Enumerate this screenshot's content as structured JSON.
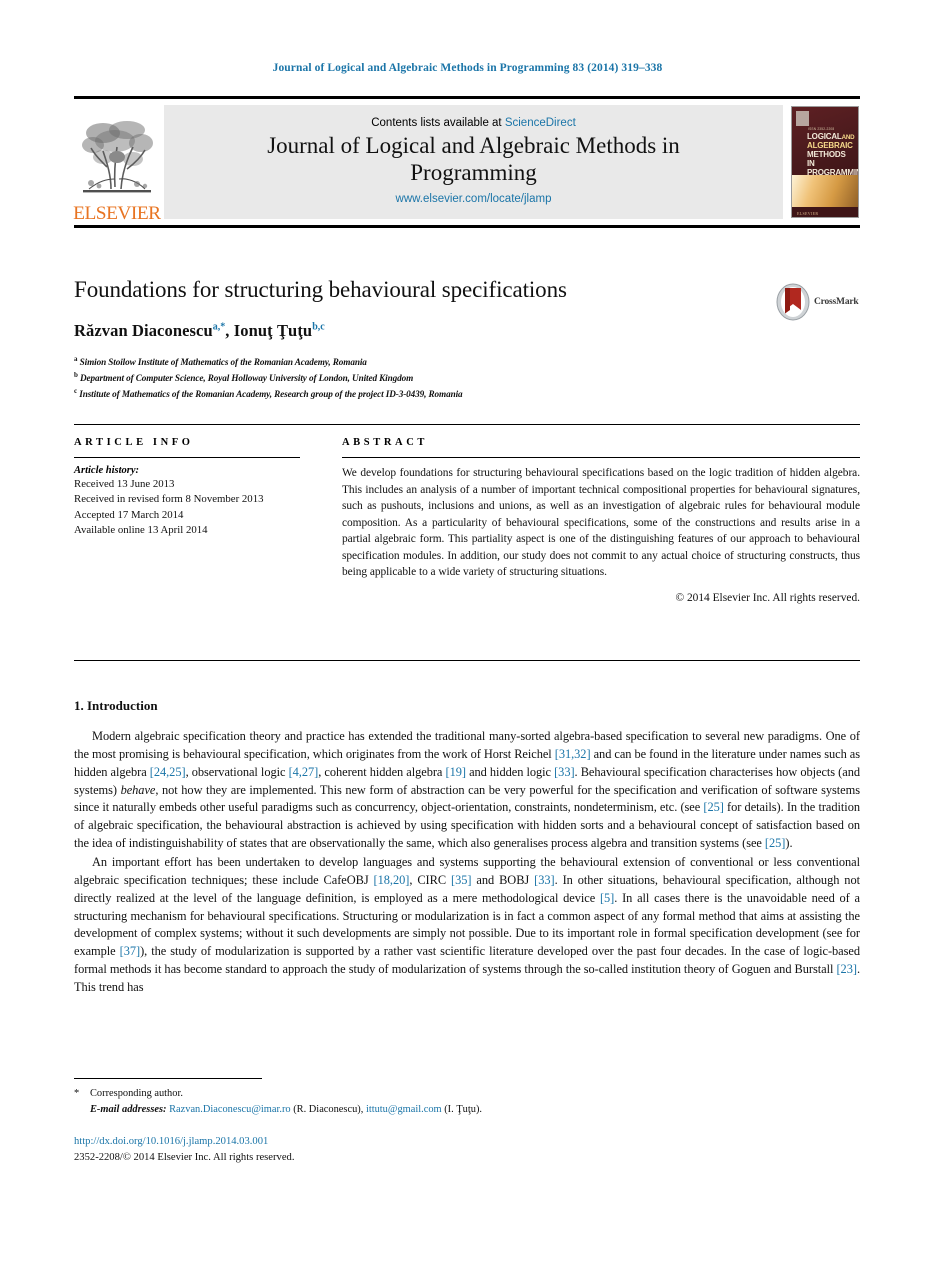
{
  "running_head": "Journal of Logical and Algebraic Methods in Programming 83 (2014) 319–338",
  "masthead": {
    "publisher_name": "ELSEVIER",
    "contents_prefix": "Contents lists available at",
    "contents_link": "ScienceDirect",
    "journal_title": "Journal of Logical and Algebraic Methods in Programming",
    "journal_url": "www.elsevier.com/locate/jlamp",
    "cover": {
      "kicker": "ISSN 2352-2208",
      "line1": "LOGICAL",
      "line1_small": "AND",
      "line2": "ALGEBRAIC",
      "line3": "METHODS IN",
      "line4": "PROGRAMMING",
      "footer": "ELSEVIER"
    }
  },
  "article": {
    "title": "Foundations for structuring behavioural specifications",
    "authors": [
      {
        "name": "Răzvan Diaconescu",
        "marks": "a,*"
      },
      {
        "name": "Ionuţ Ţuţu",
        "marks": "b,c"
      }
    ],
    "authors_separator": ", ",
    "affiliations": [
      {
        "mark": "a",
        "text": "Simion Stoilow Institute of Mathematics of the Romanian Academy, Romania"
      },
      {
        "mark": "b",
        "text": "Department of Computer Science, Royal Holloway University of London, United Kingdom"
      },
      {
        "mark": "c",
        "text": "Institute of Mathematics of the Romanian Academy, Research group of the project ID-3-0439, Romania"
      }
    ],
    "crossmark_label": "CrossMark"
  },
  "article_info": {
    "heading": "ARTICLE INFO",
    "history_label": "Article history:",
    "history": [
      "Received 13 June 2013",
      "Received in revised form 8 November 2013",
      "Accepted 17 March 2014",
      "Available online 13 April 2014"
    ]
  },
  "abstract": {
    "heading": "ABSTRACT",
    "text": "We develop foundations for structuring behavioural specifications based on the logic tradition of hidden algebra. This includes an analysis of a number of important technical compositional properties for behavioural signatures, such as pushouts, inclusions and unions, as well as an investigation of algebraic rules for behavioural module composition. As a particularity of behavioural specifications, some of the constructions and results arise in a partial algebraic form. This partiality aspect is one of the distinguishing features of our approach to behavioural specification modules. In addition, our study does not commit to any actual choice of structuring constructs, thus being applicable to a wide variety of structuring situations.",
    "copyright": "© 2014 Elsevier Inc. All rights reserved."
  },
  "body": {
    "section_number": "1.",
    "section_title": "Introduction",
    "paragraphs": [
      {
        "segments": [
          {
            "t": "Modern algebraic specification theory and practice has extended the traditional many-sorted algebra-based specification to several new paradigms. One of the most promising is behavioural specification, which originates from the work of Horst Reichel "
          },
          {
            "t": "[31,32]",
            "k": "ref"
          },
          {
            "t": " and can be found in the literature under names such as hidden algebra "
          },
          {
            "t": "[24,25]",
            "k": "ref"
          },
          {
            "t": ", observational logic "
          },
          {
            "t": "[4,27]",
            "k": "ref"
          },
          {
            "t": ", coherent hidden algebra "
          },
          {
            "t": "[19]",
            "k": "ref"
          },
          {
            "t": " and hidden logic "
          },
          {
            "t": "[33]",
            "k": "ref"
          },
          {
            "t": ". Behavioural specification characterises how objects (and systems) "
          },
          {
            "t": "behave",
            "k": "it"
          },
          {
            "t": ", not how they are implemented. This new form of abstraction can be very powerful for the specification and verification of software systems since it naturally embeds other useful paradigms such as concurrency, object-orientation, constraints, nondeterminism, etc. (see "
          },
          {
            "t": "[25]",
            "k": "ref"
          },
          {
            "t": " for details). In the tradition of algebraic specification, the behavioural abstraction is achieved by using specification with hidden sorts and a behavioural concept of satisfaction based on the idea of indistinguishability of states that are observationally the same, which also generalises process algebra and transition systems (see "
          },
          {
            "t": "[25]",
            "k": "ref"
          },
          {
            "t": ")."
          }
        ]
      },
      {
        "segments": [
          {
            "t": "An important effort has been undertaken to develop languages and systems supporting the behavioural extension of conventional or less conventional algebraic specification techniques; these include CafeOBJ "
          },
          {
            "t": "[18,20]",
            "k": "ref"
          },
          {
            "t": ", CIRC "
          },
          {
            "t": "[35]",
            "k": "ref"
          },
          {
            "t": " and BOBJ "
          },
          {
            "t": "[33]",
            "k": "ref"
          },
          {
            "t": ". In other situations, behavioural specification, although not directly realized at the level of the language definition, is employed as a mere methodological device "
          },
          {
            "t": "[5]",
            "k": "ref"
          },
          {
            "t": ". In all cases there is the unavoidable need of a structuring mechanism for behavioural specifications. Structuring or modularization is in fact a common aspect of any formal method that aims at assisting the development of complex systems; without it such developments are simply not possible. Due to its important role in formal specification development (see for example "
          },
          {
            "t": "[37]",
            "k": "ref"
          },
          {
            "t": "), the study of modularization is supported by a rather vast scientific literature developed over the past four decades. In the case of logic-based formal methods it has become standard to approach the study of modularization of systems through the so-called institution theory of Goguen and Burstall "
          },
          {
            "t": "[23]",
            "k": "ref"
          },
          {
            "t": ". This trend has"
          }
        ]
      }
    ]
  },
  "footnotes": {
    "corresponding_mark": "*",
    "corresponding_text": "Corresponding author.",
    "email_label": "E-mail addresses:",
    "emails": [
      {
        "address": "Razvan.Diaconescu@imar.ro",
        "owner": "(R. Diaconescu)"
      },
      {
        "address": "ittutu@gmail.com",
        "owner": "(I. Ţuţu)"
      }
    ],
    "email_separator": ", "
  },
  "footer": {
    "doi": "http://dx.doi.org/10.1016/j.jlamp.2014.03.001",
    "issn_line": "2352-2208/© 2014 Elsevier Inc. All rights reserved."
  },
  "colors": {
    "link": "#1b75a8",
    "elsevier_orange": "#e87422",
    "band_gray": "#e9e9e9"
  }
}
